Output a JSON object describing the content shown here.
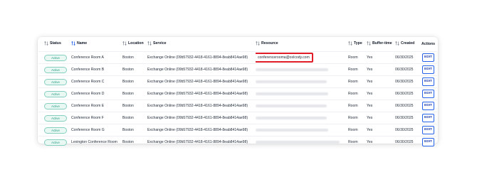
{
  "table": {
    "headers": {
      "status": "Status",
      "name": "Name",
      "location": "Location",
      "service": "Service",
      "resource": "Resource",
      "type": "Type",
      "buffer_time": "Buffer-time",
      "created": "Created",
      "actions": "Actions"
    },
    "edit_label": "EDIT",
    "highlight_color": "#e11d2a",
    "rows": [
      {
        "status": "Active",
        "name": "Conference Room A",
        "location": "Boston",
        "service": "Exchange Online (09b57932-4418-4161-8894-8eab8414ae98)",
        "resource": "conferencerooma@oxlcody.com",
        "type": "Room",
        "buffer": "Yes",
        "created": "06/30/2025"
      },
      {
        "status": "Active",
        "name": "Conference Room B",
        "location": "Boston",
        "service": "Exchange Online (09b57932-4418-4161-8894-8eab8414ae98)",
        "resource": "",
        "type": "Room",
        "buffer": "Yes",
        "created": "06/30/2025"
      },
      {
        "status": "Active",
        "name": "Conference Room C",
        "location": "Boston",
        "service": "Exchange Online (09b57932-4418-4161-8894-8eab8414ae98)",
        "resource": "",
        "type": "Room",
        "buffer": "Yes",
        "created": "06/30/2025"
      },
      {
        "status": "Active",
        "name": "Conference Room D",
        "location": "Boston",
        "service": "Exchange Online (09b57932-4418-4161-8894-8eab8414ae98)",
        "resource": "",
        "type": "Room",
        "buffer": "Yes",
        "created": "06/30/2025"
      },
      {
        "status": "Active",
        "name": "Conference Room E",
        "location": "Boston",
        "service": "Exchange Online (09b57932-4418-4161-8894-8eab8414ae98)",
        "resource": "",
        "type": "Room",
        "buffer": "Yes",
        "created": "06/30/2025"
      },
      {
        "status": "Active",
        "name": "Conference Room F",
        "location": "Boston",
        "service": "Exchange Online (09b57932-4418-4161-8894-8eab8414ae98)",
        "resource": "",
        "type": "Room",
        "buffer": "Yes",
        "created": "06/30/2025"
      },
      {
        "status": "Active",
        "name": "Conference Room G",
        "location": "Boston",
        "service": "Exchange Online (09b57932-4418-4161-8894-8eab8414ae98)",
        "resource": "",
        "type": "Room",
        "buffer": "Yes",
        "created": "06/30/2025"
      },
      {
        "status": "Active",
        "name": "Lexington Conference Room",
        "location": "Boston",
        "service": "Exchange Online (09b57932-4418-4161-8894-8eab8414ae98)",
        "resource": "",
        "type": "Room",
        "buffer": "Yes",
        "created": "06/30/2025"
      }
    ]
  }
}
